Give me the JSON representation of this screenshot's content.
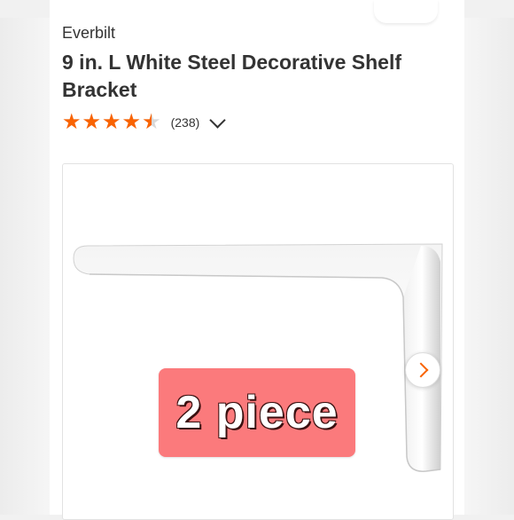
{
  "product": {
    "brand": "Everbilt",
    "title": "9 in. L White Steel Decorative Shelf Bracket"
  },
  "rating": {
    "stars": "★★★★★",
    "value_fraction": 0.9,
    "review_count": "(238)",
    "star_color": "#f96302",
    "empty_star_color": "#d9d9d9"
  },
  "image": {
    "badge_text": "2 piece",
    "badge_color": "#fb7a7c",
    "next_icon": "chevron-right-icon"
  },
  "colors": {
    "accent": "#f96302",
    "text": "#333333"
  }
}
